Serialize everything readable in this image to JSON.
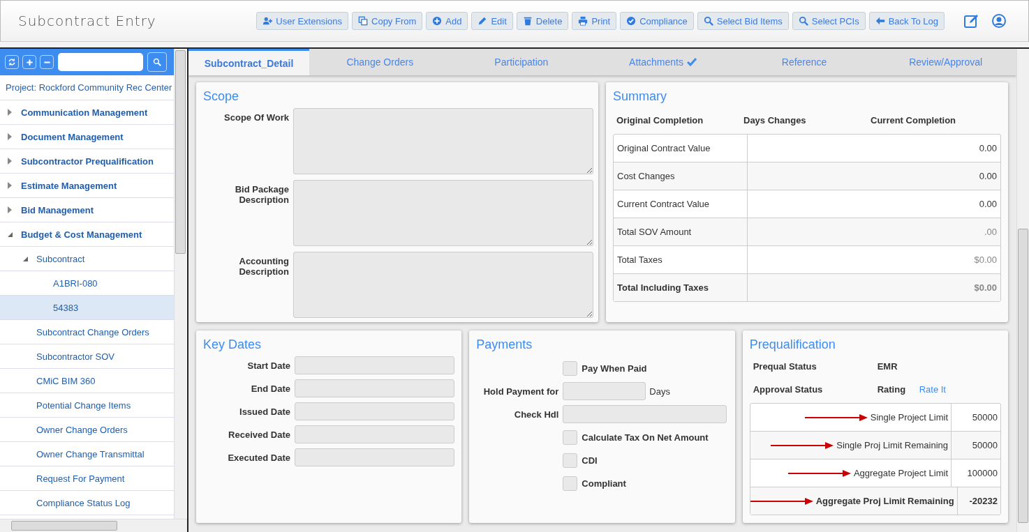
{
  "header": {
    "title": "Subcontract Entry",
    "buttons": [
      "User Extensions",
      "Copy From",
      "Add",
      "Edit",
      "Delete",
      "Print",
      "Compliance",
      "Select Bid Items",
      "Select PCIs",
      "Back To Log"
    ]
  },
  "sidebar": {
    "project": "Project: Rockford Community Rec Center",
    "items": [
      {
        "label": "Communication Management",
        "expanded": false,
        "selected": false
      },
      {
        "label": "Document Management",
        "expanded": false,
        "selected": false
      },
      {
        "label": "Subcontractor Prequalification",
        "expanded": false,
        "selected": false
      },
      {
        "label": "Estimate Management",
        "expanded": false,
        "selected": false
      },
      {
        "label": "Bid Management",
        "expanded": false,
        "selected": false
      },
      {
        "label": "Budget & Cost Management",
        "expanded": true,
        "selected": false,
        "children": [
          {
            "label": "Subcontract",
            "expanded": true,
            "selected": false,
            "children": [
              {
                "label": "A1BRI-080",
                "selected": false
              },
              {
                "label": "54383",
                "selected": true
              }
            ]
          },
          {
            "label": "Subcontract Change Orders",
            "selected": false
          },
          {
            "label": "Subcontractor SOV",
            "selected": false
          },
          {
            "label": "CMiC BIM 360",
            "selected": false
          },
          {
            "label": "Potential Change Items",
            "selected": false
          },
          {
            "label": "Owner Change Orders",
            "selected": false
          },
          {
            "label": "Owner Change Transmittal",
            "selected": false
          },
          {
            "label": "Request For Payment",
            "selected": false
          },
          {
            "label": "Compliance Status Log",
            "selected": false
          }
        ]
      }
    ]
  },
  "tabs": [
    {
      "label": "Subcontract_Detail",
      "selected": true,
      "complete": false
    },
    {
      "label": "Change Orders",
      "selected": false,
      "complete": false
    },
    {
      "label": "Participation",
      "selected": false,
      "complete": false
    },
    {
      "label": "Attachments",
      "selected": false,
      "complete": true
    },
    {
      "label": "Reference",
      "selected": false,
      "complete": false
    },
    {
      "label": "Review/Approval",
      "selected": false,
      "complete": false
    }
  ],
  "scope": {
    "title": "Scope",
    "fields": [
      "Scope Of Work",
      "Bid Package Description",
      "Accounting Description"
    ]
  },
  "summary": {
    "title": "Summary",
    "headers": [
      "Original Completion",
      "Days Changes",
      "Current Completion"
    ],
    "rows": [
      {
        "label": "Original Contract Value",
        "value": "0.00",
        "kind": "input"
      },
      {
        "label": "Cost Changes",
        "value": "0.00",
        "kind": "input"
      },
      {
        "label": "Current Contract Value",
        "value": "0.00",
        "kind": "input"
      },
      {
        "label": "Total SOV Amount",
        "value": ".00",
        "kind": "computed"
      },
      {
        "label": "Total Taxes",
        "value": "$0.00",
        "kind": "computed"
      },
      {
        "label": "Total Including Taxes",
        "value": "$0.00",
        "kind": "total"
      }
    ]
  },
  "key_dates": {
    "title": "Key Dates",
    "fields": [
      "Start Date",
      "End Date",
      "Issued Date",
      "Received Date",
      "Executed Date"
    ]
  },
  "payments": {
    "title": "Payments",
    "items": [
      {
        "kind": "checkbox",
        "label": "Pay When Paid",
        "checked": false
      },
      {
        "kind": "field",
        "label": "Hold Payment for",
        "unit": "Days"
      },
      {
        "kind": "field",
        "label": "Check Hdl"
      },
      {
        "kind": "checkbox",
        "label": "Calculate Tax On Net Amount",
        "checked": false
      },
      {
        "kind": "checkbox",
        "label": "CDI",
        "checked": false
      },
      {
        "kind": "checkbox",
        "label": "Compliant",
        "checked": false
      }
    ]
  },
  "prequalification": {
    "title": "Prequalification",
    "labels": [
      "Prequal Status",
      "EMR",
      "Approval Status",
      "Rating"
    ],
    "rate_link": "Rate It",
    "rows": [
      {
        "label": "Single Project Limit",
        "value": "50000",
        "bold": false,
        "annotated": true
      },
      {
        "label": "Single Proj Limit Remaining",
        "value": "50000",
        "bold": false,
        "annotated": true
      },
      {
        "label": "Aggregate Project Limit",
        "value": "100000",
        "bold": false,
        "annotated": true
      },
      {
        "label": "Aggregate Proj Limit Remaining",
        "value": "-20232",
        "bold": true,
        "annotated": true
      }
    ]
  }
}
